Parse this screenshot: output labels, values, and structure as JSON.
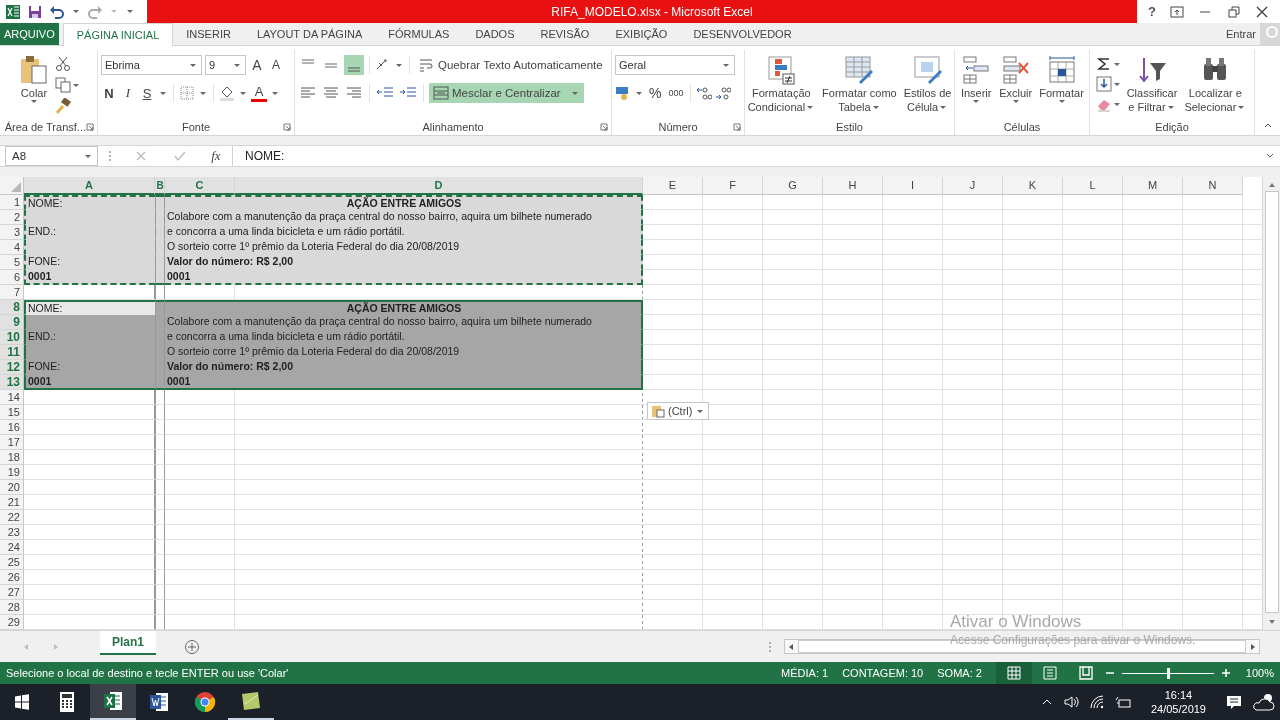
{
  "window": {
    "title": "RIFA_MODELO.xlsx -  Microsoft Excel",
    "help": "?"
  },
  "ribbon_tabs": [
    {
      "label": "ARQUIVO",
      "kind": "file",
      "selected": false
    },
    {
      "label": "PÁGINA INICIAL",
      "kind": "tab",
      "selected": true
    },
    {
      "label": "INSERIR",
      "kind": "tab",
      "selected": false
    },
    {
      "label": "LAYOUT DA PÁGINA",
      "kind": "tab",
      "selected": false
    },
    {
      "label": "FÓRMULAS",
      "kind": "tab",
      "selected": false
    },
    {
      "label": "DADOS",
      "kind": "tab",
      "selected": false
    },
    {
      "label": "REVISÃO",
      "kind": "tab",
      "selected": false
    },
    {
      "label": "EXIBIÇÃO",
      "kind": "tab",
      "selected": false
    },
    {
      "label": "DESENVOLVEDOR",
      "kind": "tab",
      "selected": false
    }
  ],
  "account": {
    "label": "Entrar"
  },
  "clipboard": {
    "paste": "Colar",
    "label": "Área de Transf..."
  },
  "font": {
    "family": "Ebrima",
    "size": "9",
    "grow": "A",
    "shrink": "A",
    "bold": "N",
    "italic": "I",
    "underline": "S",
    "color_letter": "A",
    "label": "Fonte"
  },
  "alignment": {
    "vertical": [
      {
        "kind": "top",
        "selected": false
      },
      {
        "kind": "middle",
        "selected": false
      },
      {
        "kind": "bottom",
        "selected": true
      }
    ],
    "wrap": {
      "label": "Quebrar Texto Automaticamente",
      "selected": false
    },
    "merge": {
      "label": "Mesclar e Centralizar",
      "selected": true
    },
    "label": "Alinhamento"
  },
  "number": {
    "format": "Geral",
    "percent": "%",
    "thousands": "000",
    "label": "Número"
  },
  "styles": {
    "buttons": [
      {
        "kind": "conditional",
        "lines": [
          "Formatação",
          "Condicional"
        ]
      },
      {
        "kind": "table",
        "lines": [
          "Formatar como",
          "Tabela"
        ]
      },
      {
        "kind": "cellstyle",
        "lines": [
          "Estilos de",
          "Célula"
        ]
      }
    ],
    "label": "Estilo"
  },
  "cells": {
    "buttons": [
      {
        "kind": "insert",
        "label": "Inserir"
      },
      {
        "kind": "delete",
        "label": "Excluir"
      },
      {
        "kind": "format",
        "label": "Formatar"
      }
    ],
    "label": "Células"
  },
  "editing": {
    "buttons": [
      {
        "kind": "sort",
        "lines": [
          "Classificar",
          "e Filtrar"
        ]
      },
      {
        "kind": "find",
        "lines": [
          "Localizar e",
          "Selecionar"
        ]
      }
    ],
    "label": "Edição"
  },
  "formula_bar": {
    "name_box": "A8",
    "function_symbol": "fx",
    "formula": "NOME:"
  },
  "sheet": {
    "columns": [
      {
        "label": "A",
        "selected": true
      },
      {
        "label": "B",
        "selected": true
      },
      {
        "label": "C",
        "selected": true
      },
      {
        "label": "D",
        "selected": true
      },
      {
        "label": "E",
        "selected": false
      },
      {
        "label": "F",
        "selected": false
      },
      {
        "label": "G",
        "selected": false
      },
      {
        "label": "H",
        "selected": false
      },
      {
        "label": "I",
        "selected": false
      },
      {
        "label": "J",
        "selected": false
      },
      {
        "label": "K",
        "selected": false
      },
      {
        "label": "L",
        "selected": false
      },
      {
        "label": "M",
        "selected": false
      },
      {
        "label": "N",
        "selected": false
      }
    ],
    "rows": [
      {
        "number": "1",
        "copied": true,
        "selected": false,
        "active": false,
        "a": {
          "text": "NOME:",
          "bold": false
        },
        "c": {
          "text": "AÇÃO ENTRE AMIGOS",
          "kind": "title"
        }
      },
      {
        "number": "2",
        "copied": true,
        "selected": false,
        "active": false,
        "c": {
          "text": "Colabore com a manutenção da praça central do nosso bairro, aquira um bilhete numerado",
          "kind": "plain"
        }
      },
      {
        "number": "3",
        "copied": true,
        "selected": false,
        "active": false,
        "a": {
          "text": "END.:",
          "bold": false
        },
        "c": {
          "text": "e concorra a uma linda bicicleta e um rádio portátil.",
          "kind": "plain"
        }
      },
      {
        "number": "4",
        "copied": true,
        "selected": false,
        "active": false,
        "c": {
          "text": "O sorteio corre 1º prêmio da Loteria Federal do dia 20/08/2019",
          "kind": "plain"
        }
      },
      {
        "number": "5",
        "copied": true,
        "selected": false,
        "active": false,
        "a": {
          "text": "FONE:",
          "bold": false
        },
        "c": {
          "text": "Valor do número:  R$ 2,00",
          "kind": "bold"
        }
      },
      {
        "number": "6",
        "copied": true,
        "selected": false,
        "active": false,
        "a": {
          "text": "0001",
          "bold": true
        },
        "c": {
          "text": "0001",
          "kind": "bold"
        }
      },
      {
        "number": "7",
        "copied": false,
        "selected": false,
        "active": false
      },
      {
        "number": "8",
        "copied": false,
        "selected": true,
        "active": true,
        "a": {
          "text": "NOME:",
          "bold": false
        },
        "c": {
          "text": "AÇÃO ENTRE AMIGOS",
          "kind": "title"
        }
      },
      {
        "number": "9",
        "copied": false,
        "selected": true,
        "active": false,
        "c": {
          "text": "Colabore com a manutenção da praça central do nosso bairro, aquira um bilhete numerado",
          "kind": "plain"
        }
      },
      {
        "number": "10",
        "copied": false,
        "selected": true,
        "active": false,
        "a": {
          "text": "END.:",
          "bold": false
        },
        "c": {
          "text": "e concorra a uma linda bicicleta e um rádio portátil.",
          "kind": "plain"
        }
      },
      {
        "number": "11",
        "copied": false,
        "selected": true,
        "active": false,
        "c": {
          "text": "O sorteio corre 1º prêmio da Loteria Federal do dia 20/08/2019",
          "kind": "plain"
        }
      },
      {
        "number": "12",
        "copied": false,
        "selected": true,
        "active": false,
        "a": {
          "text": "FONE:",
          "bold": false
        },
        "c": {
          "text": "Valor do número:  R$ 2,00",
          "kind": "bold"
        }
      },
      {
        "number": "13",
        "copied": false,
        "selected": true,
        "active": false,
        "a": {
          "text": "0001",
          "bold": true
        },
        "c": {
          "text": "0001",
          "kind": "bold"
        }
      },
      {
        "number": "14",
        "copied": false,
        "selected": false,
        "active": false
      },
      {
        "number": "15",
        "copied": false,
        "selected": false,
        "active": false
      },
      {
        "number": "16",
        "copied": false,
        "selected": false,
        "active": false
      },
      {
        "number": "17",
        "copied": false,
        "selected": false,
        "active": false
      },
      {
        "number": "18",
        "copied": false,
        "selected": false,
        "active": false
      },
      {
        "number": "19",
        "copied": false,
        "selected": false,
        "active": false
      },
      {
        "number": "20",
        "copied": false,
        "selected": false,
        "active": false
      },
      {
        "number": "21",
        "copied": false,
        "selected": false,
        "active": false
      },
      {
        "number": "22",
        "copied": false,
        "selected": false,
        "active": false
      },
      {
        "number": "23",
        "copied": false,
        "selected": false,
        "active": false
      },
      {
        "number": "24",
        "copied": false,
        "selected": false,
        "active": false
      },
      {
        "number": "25",
        "copied": false,
        "selected": false,
        "active": false
      },
      {
        "number": "26",
        "copied": false,
        "selected": false,
        "active": false
      },
      {
        "number": "27",
        "copied": false,
        "selected": false,
        "active": false
      },
      {
        "number": "28",
        "copied": false,
        "selected": false,
        "active": false
      },
      {
        "number": "29",
        "copied": false,
        "selected": false,
        "active": false
      }
    ],
    "paste_options": {
      "label": "(Ctrl)"
    }
  },
  "activation_notice": {
    "title": "Ativar o Windows",
    "text": "Acesse Configurações para ativar o Windows."
  },
  "sheet_tabs": [
    {
      "label": "Plan1",
      "selected": true
    }
  ],
  "status_bar": {
    "message": "Selecione o local de destino e tecle ENTER ou use 'Colar'",
    "stats": [
      "MÉDIA: 1",
      "CONTAGEM: 10",
      "SOMA: 2"
    ],
    "views": [
      {
        "kind": "normal",
        "selected": true
      },
      {
        "kind": "layout",
        "selected": false
      },
      {
        "kind": "pagebreak",
        "selected": false
      }
    ],
    "zoom": {
      "level": 0.5,
      "label": "100%"
    }
  },
  "taskbar": {
    "apps": [
      {
        "kind": "calculator",
        "selected": false,
        "running": false
      },
      {
        "kind": "excel",
        "selected": true,
        "running": true
      },
      {
        "kind": "word",
        "selected": false,
        "running": false
      },
      {
        "kind": "chrome",
        "selected": false,
        "running": false
      },
      {
        "kind": "tile",
        "selected": false,
        "running": true
      }
    ],
    "time": "16:14",
    "date": "24/05/2019"
  }
}
